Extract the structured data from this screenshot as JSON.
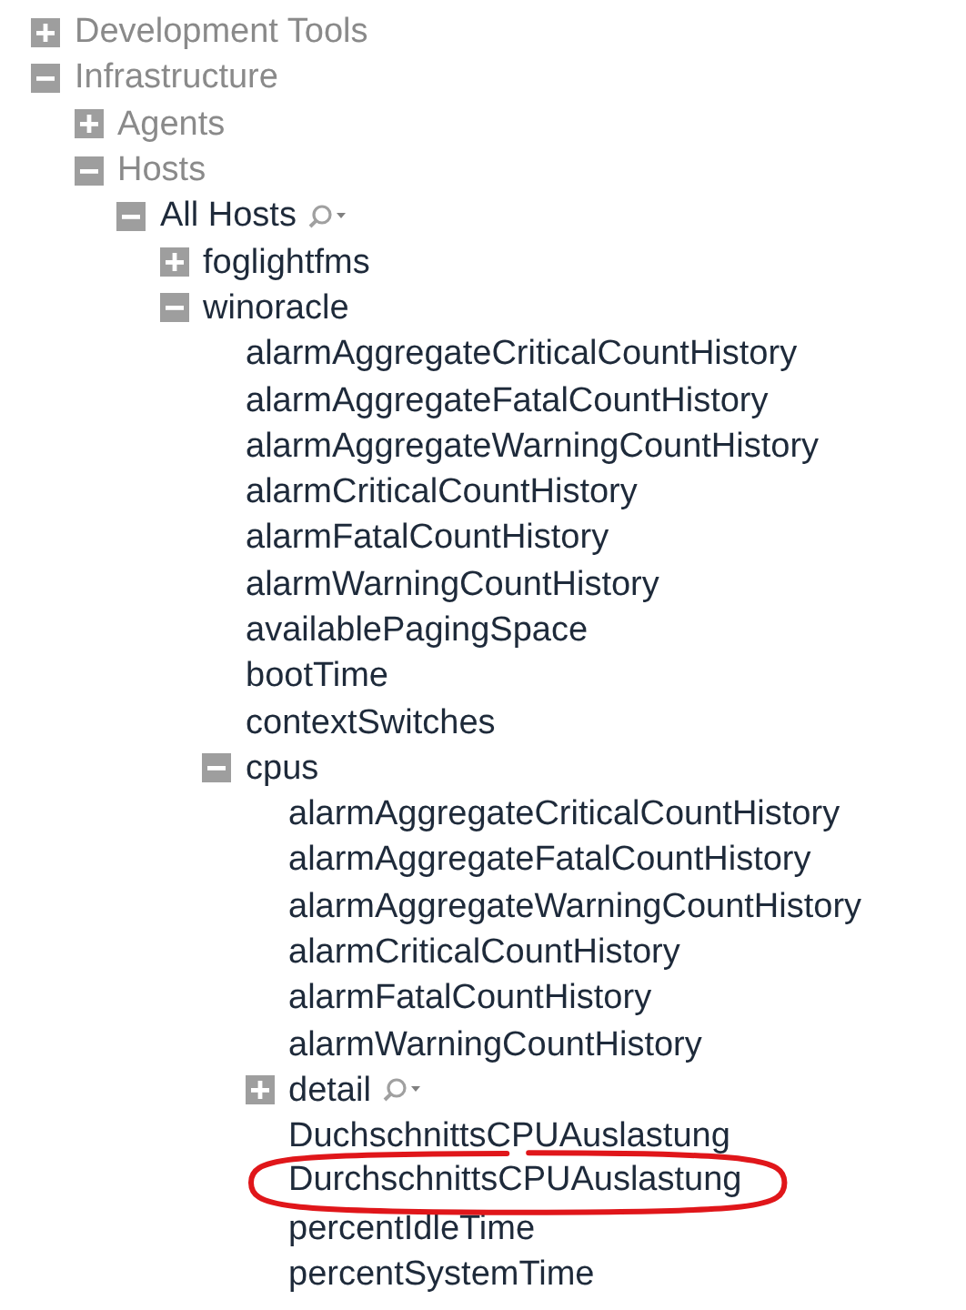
{
  "tree": [
    {
      "label": "Development Tools",
      "expanded": false,
      "dimmed": true
    },
    {
      "label": "Infrastructure",
      "expanded": true,
      "dimmed": true,
      "children": [
        {
          "label": "Agents",
          "expanded": false,
          "dimmed": true
        },
        {
          "label": "Hosts",
          "expanded": true,
          "dimmed": true,
          "children": [
            {
              "label": "All Hosts",
              "expanded": true,
              "dimmed": false,
              "search_menu": true,
              "children": [
                {
                  "label": "foglightfms",
                  "expanded": false,
                  "dimmed": false
                },
                {
                  "label": "winoracle",
                  "expanded": true,
                  "dimmed": false,
                  "children": [
                    {
                      "label": "alarmAggregateCriticalCountHistory"
                    },
                    {
                      "label": "alarmAggregateFatalCountHistory"
                    },
                    {
                      "label": "alarmAggregateWarningCountHistory"
                    },
                    {
                      "label": "alarmCriticalCountHistory"
                    },
                    {
                      "label": "alarmFatalCountHistory"
                    },
                    {
                      "label": "alarmWarningCountHistory"
                    },
                    {
                      "label": "availablePagingSpace"
                    },
                    {
                      "label": "bootTime"
                    },
                    {
                      "label": "contextSwitches"
                    },
                    {
                      "label": "cpus",
                      "expanded": true,
                      "dimmed": false,
                      "children": [
                        {
                          "label": "alarmAggregateCriticalCountHistory"
                        },
                        {
                          "label": "alarmAggregateFatalCountHistory"
                        },
                        {
                          "label": "alarmAggregateWarningCountHistory"
                        },
                        {
                          "label": "alarmCriticalCountHistory"
                        },
                        {
                          "label": "alarmFatalCountHistory"
                        },
                        {
                          "label": "alarmWarningCountHistory"
                        },
                        {
                          "label": "detail",
                          "expanded": false,
                          "dimmed": false,
                          "search_menu": true
                        },
                        {
                          "label": "DuchschnittsCPUAuslastung"
                        },
                        {
                          "label": "DurchschnittsCPUAuslastung",
                          "annotated": true
                        },
                        {
                          "label": "percentIdleTime"
                        },
                        {
                          "label": "percentSystemTime"
                        }
                      ]
                    }
                  ]
                }
              ]
            }
          ]
        }
      ]
    }
  ]
}
